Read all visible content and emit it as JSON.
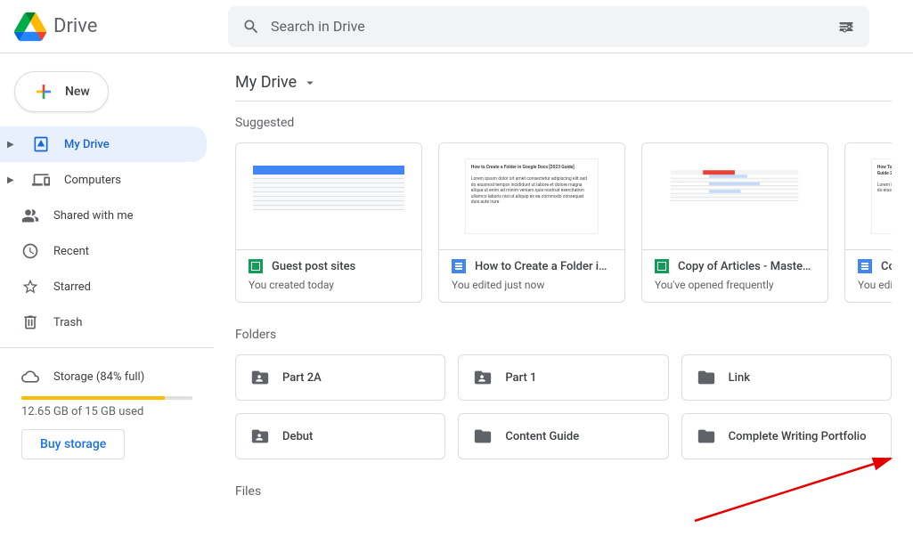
{
  "header": {
    "app_name": "Drive",
    "search_placeholder": "Search in Drive"
  },
  "sidebar": {
    "new_label": "New",
    "items": [
      {
        "label": "My Drive",
        "icon": "drive",
        "expandable": true,
        "active": true
      },
      {
        "label": "Computers",
        "icon": "computers",
        "expandable": true,
        "active": false
      },
      {
        "label": "Shared with me",
        "icon": "shared",
        "expandable": false,
        "active": false
      },
      {
        "label": "Recent",
        "icon": "recent",
        "expandable": false,
        "active": false
      },
      {
        "label": "Starred",
        "icon": "star",
        "expandable": false,
        "active": false
      },
      {
        "label": "Trash",
        "icon": "trash",
        "expandable": false,
        "active": false
      }
    ],
    "storage": {
      "label": "Storage (84% full)",
      "percent": 84,
      "used_text": "12.65 GB of 15 GB used",
      "buy_label": "Buy storage"
    }
  },
  "main": {
    "breadcrumb": "My Drive",
    "suggested_label": "Suggested",
    "suggested": [
      {
        "type": "sheets",
        "title": "Guest post sites",
        "sub": "You created today"
      },
      {
        "type": "docs",
        "title": "How to Create a Folder i…",
        "sub": "You edited just now"
      },
      {
        "type": "sheets",
        "title": "Copy of Articles - Maste…",
        "sub": "You've opened frequently"
      },
      {
        "type": "docs",
        "title": "Copy o",
        "sub": "You edited y"
      }
    ],
    "folders_label": "Folders",
    "folders": [
      {
        "name": "Part 2A",
        "shared": true
      },
      {
        "name": "Part 1",
        "shared": true
      },
      {
        "name": "Link",
        "shared": false
      },
      {
        "name": "Debut",
        "shared": true
      },
      {
        "name": "Content Guide",
        "shared": false
      },
      {
        "name": "Complete Writing Portfolio",
        "shared": false
      }
    ],
    "files_label": "Files"
  }
}
